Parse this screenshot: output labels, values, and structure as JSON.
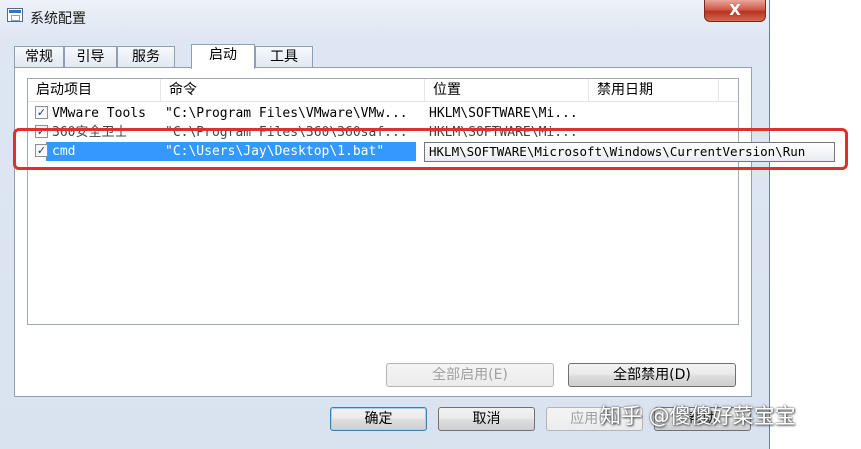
{
  "window": {
    "title": "系统配置",
    "close_label": "X"
  },
  "tabs": [
    "常规",
    "引导",
    "服务",
    "启动",
    "工具"
  ],
  "active_tab": "启动",
  "list": {
    "columns": [
      "启动项目",
      "命令",
      "位置",
      "禁用日期"
    ],
    "rows": [
      {
        "checked": true,
        "name": "VMware Tools",
        "command": "\"C:\\Program Files\\VMware\\VMw...",
        "location": "HKLM\\SOFTWARE\\Mi...",
        "disabled_date": ""
      },
      {
        "checked": true,
        "name": "360安全卫士",
        "command": "\"C:\\Program Files\\360\\360saf...",
        "location": "HKLM\\SOFTWARE\\Mi...",
        "disabled_date": ""
      },
      {
        "checked": true,
        "name": "cmd",
        "command": "\"C:\\Users\\Jay\\Desktop\\1.bat\"",
        "location": "",
        "disabled_date": "",
        "selected": true
      }
    ],
    "check_glyph": "✓"
  },
  "tooltip": "HKLM\\SOFTWARE\\Microsoft\\Windows\\CurrentVersion\\Run",
  "buttons": {
    "enable_all": "全部启用(E)",
    "disable_all": "全部禁用(D)",
    "ok": "确定",
    "cancel": "取消",
    "apply": "应用(A)",
    "help": "帮助"
  },
  "watermark": "知乎 @傻傻好菜宝宝",
  "colors": {
    "selection": "#3399ff",
    "highlight_box": "#e0302a",
    "close_button": "#c8412e"
  }
}
